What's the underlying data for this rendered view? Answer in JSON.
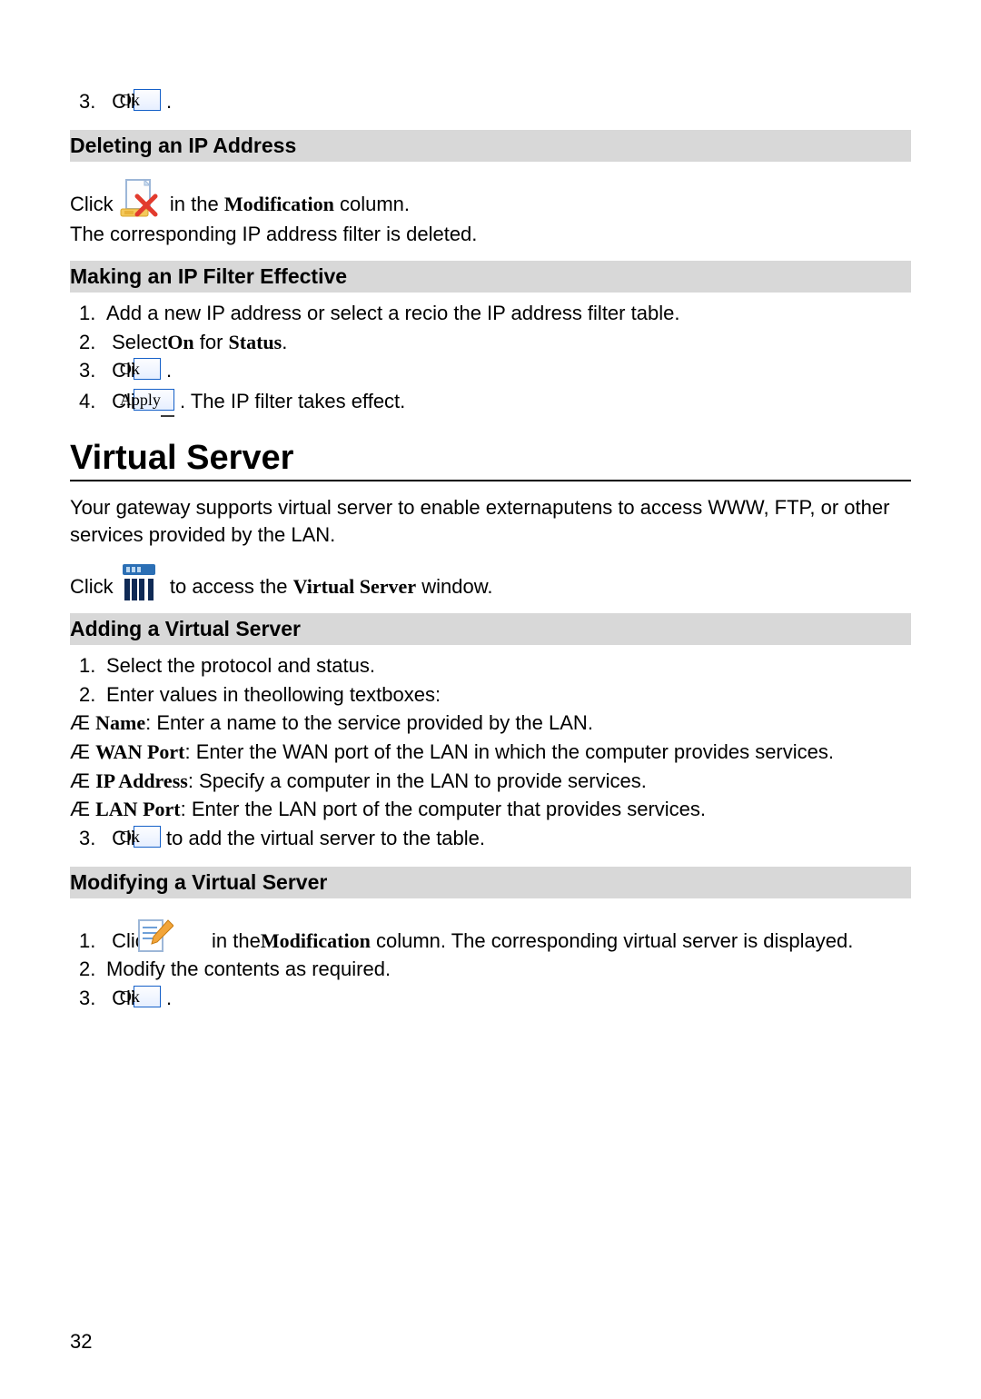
{
  "buttons": {
    "ok": "Ok",
    "apply": "Apply"
  },
  "top_step3": {
    "num": "3.",
    "pre": "Click ",
    "post": "."
  },
  "delete_ip": {
    "heading": "Deleting an IP Address",
    "line1_pre": "Click ",
    "line1_mid": " in the",
    "line1_b": "Modification",
    "line1_post": " column.",
    "line2": "The corresponding IP address filter is deleted."
  },
  "make_eff": {
    "heading": "Making an IP Filter Effective",
    "s1": {
      "num": "1.",
      "text": "Add a new IP address or select a recio the IP address filter table."
    },
    "s2": {
      "num": "2.",
      "pre": "Select",
      "b1": "On",
      "mid": " for ",
      "b2": "Status",
      "post": "."
    },
    "s3": {
      "num": "3.",
      "pre": "Click ",
      "post": "."
    },
    "s4": {
      "num": "4.",
      "pre": "Click ",
      "post": ". The IP filter takes effect."
    }
  },
  "virtual_server": {
    "h1": "Virtual Server",
    "intro": "Your gateway supports virtual server to enable externaputens to access WWW, FTP, or other services provided by the LAN.",
    "click_pre": "Click ",
    "click_mid": " to access the",
    "click_b": "Virtual Server",
    "click_post": " window."
  },
  "add_vs": {
    "heading": "Adding a Virtual Server",
    "s1": {
      "num": "1.",
      "text": "Select the protocol and status."
    },
    "s2": {
      "num": "2.",
      "text": "Enter values in theollowing textboxes:"
    },
    "b1": {
      "mark": "Æ ",
      "label": "Name",
      "text": ": Enter a name to the service provided by the LAN."
    },
    "b2": {
      "mark": "Æ ",
      "label": "WAN Port",
      "text": ": Enter the WAN port of the LAN in which the computer provides services."
    },
    "b3": {
      "mark": "Æ ",
      "label": "IP Address",
      "text": ": Specify a computer in the LAN to provide services."
    },
    "b4": {
      "mark": "Æ ",
      "label": "LAN Port",
      "text": ": Enter the LAN port of the computer that provides services."
    },
    "s3": {
      "num": "3.",
      "pre": "Click ",
      "post": " to add the virtual server to the table."
    }
  },
  "mod_vs": {
    "heading": "Modifying a Virtual Server",
    "s1": {
      "num": "1.",
      "pre": "Click ",
      "mid": " in the",
      "b": "Modification",
      "post": " column. The corresponding virtual server is displayed."
    },
    "s2": {
      "num": "2.",
      "text": "Modify the contents as required."
    },
    "s3": {
      "num": "3.",
      "pre": "Click ",
      "post": "."
    }
  },
  "page_number": "32"
}
